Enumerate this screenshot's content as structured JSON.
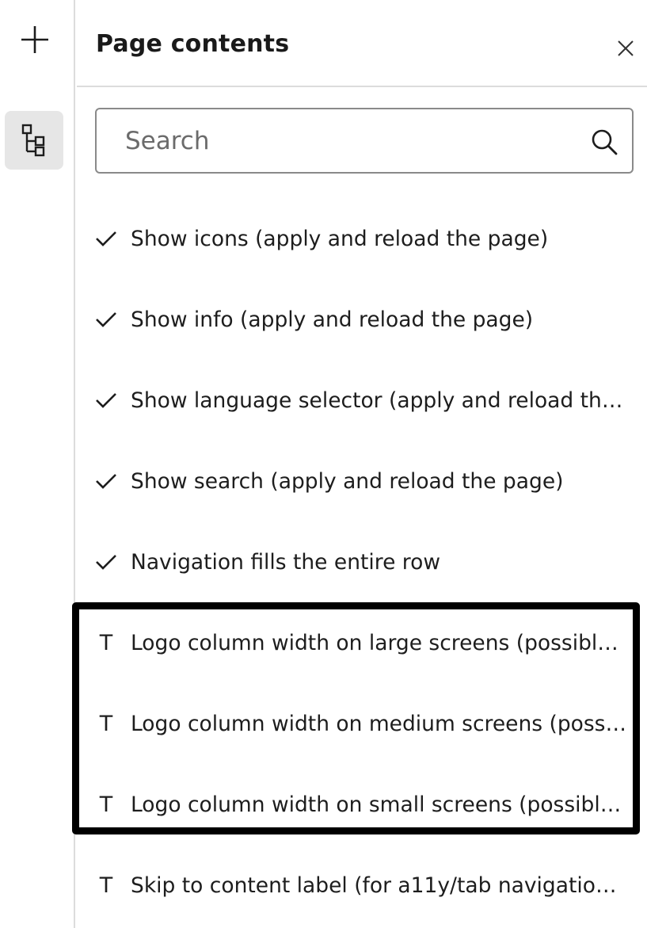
{
  "rail": {
    "add_icon": "plus-icon",
    "tree_icon": "tree-structure-icon"
  },
  "panel": {
    "title": "Page contents",
    "close_icon": "close-icon"
  },
  "search": {
    "placeholder": "Search",
    "value": "",
    "icon": "search-icon"
  },
  "items": [
    {
      "icon": "check-icon",
      "label": "Show icons (apply and reload the page)"
    },
    {
      "icon": "check-icon",
      "label": "Show info (apply and reload the page)"
    },
    {
      "icon": "check-icon",
      "label": "Show language selector (apply and reload the…"
    },
    {
      "icon": "check-icon",
      "label": "Show search (apply and reload the page)"
    },
    {
      "icon": "check-icon",
      "label": "Navigation fills the entire row"
    },
    {
      "icon": "text-field-icon",
      "glyph": "T",
      "label": "Logo column width on large screens (possible …"
    },
    {
      "icon": "text-field-icon",
      "glyph": "T",
      "label": "Logo column width on medium screens (possi…"
    },
    {
      "icon": "text-field-icon",
      "glyph": "T",
      "label": "Logo column width on small screens (possible …"
    },
    {
      "icon": "text-field-icon",
      "glyph": "T",
      "label": "Skip to content label (for a11y/tab navigation …"
    }
  ],
  "colors": {
    "highlight_border": "#000000",
    "rail_active_bg": "#e6e6e6",
    "divider": "#dcdcdc"
  }
}
